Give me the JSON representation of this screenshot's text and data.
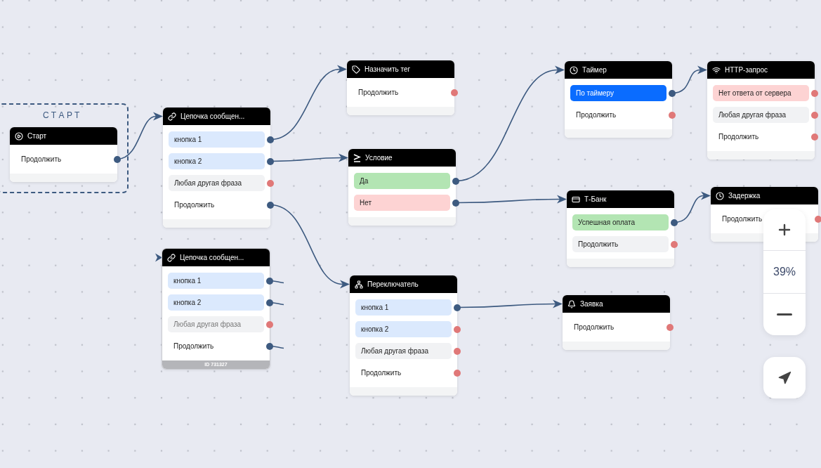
{
  "start_group": {
    "label": "СТАРТ"
  },
  "nodes": [
    {
      "kind": "start",
      "title": "Старт",
      "selected": false,
      "rows": [
        {
          "kind": "plain",
          "label": "Продолжить",
          "connected": true
        }
      ]
    },
    {
      "kind": "chain",
      "title": "Цепочка сообщен...",
      "selected": false,
      "rows": [
        {
          "kind": "button",
          "label": "кнопка 1",
          "connected": true
        },
        {
          "kind": "button",
          "label": "кнопка 2",
          "connected": true
        },
        {
          "kind": "any",
          "label": "Любая другая фраза",
          "connected": false
        },
        {
          "kind": "plain",
          "label": "Продолжить",
          "connected": true
        }
      ]
    },
    {
      "kind": "tag",
      "title": "Назначить тег",
      "selected": false,
      "rows": [
        {
          "kind": "plain",
          "label": "Продолжить",
          "connected": false
        }
      ]
    },
    {
      "kind": "condition",
      "title": "Условие",
      "selected": false,
      "rows": [
        {
          "kind": "positive",
          "label": "Да",
          "connected": true
        },
        {
          "kind": "negative",
          "label": "Нет",
          "connected": true
        }
      ]
    },
    {
      "kind": "timer",
      "title": "Таймер",
      "selected": false,
      "rows": [
        {
          "kind": "primary",
          "label": "По таймеру",
          "connected": true
        },
        {
          "kind": "plain",
          "label": "Продолжить",
          "connected": false
        }
      ]
    },
    {
      "kind": "http",
      "title": "HTTP-запрос",
      "selected": false,
      "rows": [
        {
          "kind": "negative",
          "label": "Нет ответа от сервера",
          "connected": false
        },
        {
          "kind": "any",
          "label": "Любая другая фраза",
          "connected": false
        },
        {
          "kind": "plain",
          "label": "Продолжить",
          "connected": false
        }
      ]
    },
    {
      "kind": "payment",
      "title": "Т-Банк",
      "selected": false,
      "rows": [
        {
          "kind": "positive",
          "label": "Успешная оплата",
          "connected": true
        },
        {
          "kind": "any",
          "label": "Продолжить",
          "connected": false
        }
      ]
    },
    {
      "kind": "delay",
      "title": "Задержка",
      "selected": false,
      "rows": [
        {
          "kind": "plain",
          "label": "Продолжить",
          "connected": false
        }
      ]
    },
    {
      "kind": "chain",
      "title": "Цепочка сообщен...",
      "selected": true,
      "id": "ID 731327",
      "rows": [
        {
          "kind": "button",
          "label": "кнопка 1",
          "connected": true
        },
        {
          "kind": "button",
          "label": "кнопка 2",
          "connected": true
        },
        {
          "kind": "any",
          "label": "Любая другая фраза",
          "connected": false
        },
        {
          "kind": "plain",
          "label": "Продолжить",
          "connected": true
        }
      ]
    },
    {
      "kind": "switch",
      "title": "Переключатель",
      "selected": false,
      "rows": [
        {
          "kind": "button",
          "label": "кнопка 1",
          "connected": true
        },
        {
          "kind": "button",
          "label": "кнопка 2",
          "connected": false
        },
        {
          "kind": "any",
          "label": "Любая другая фраза",
          "connected": false
        },
        {
          "kind": "plain",
          "label": "Продолжить",
          "connected": false
        }
      ]
    },
    {
      "kind": "request",
      "title": "Заявка",
      "selected": false,
      "rows": [
        {
          "kind": "plain",
          "label": "Продолжить",
          "connected": false
        }
      ]
    }
  ],
  "zoom": {
    "label": "39%"
  }
}
